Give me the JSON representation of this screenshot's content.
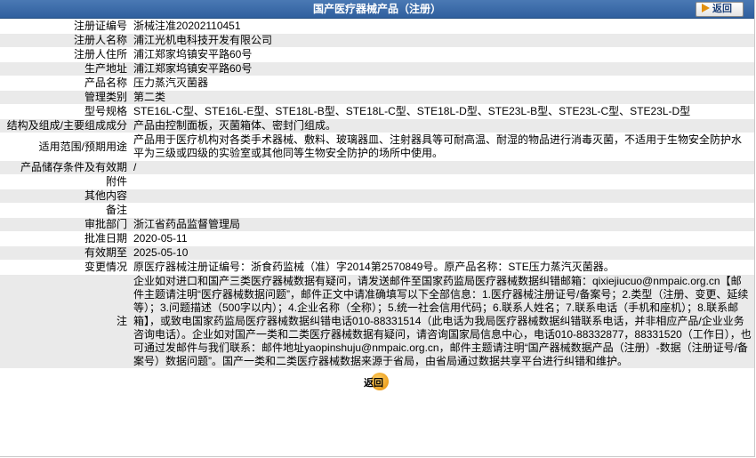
{
  "header": {
    "title": "国产医疗器械产品（注册）",
    "back_label": "返回"
  },
  "rows": [
    {
      "label": "注册证编号",
      "value": "浙械注准20202110451"
    },
    {
      "label": "注册人名称",
      "value": "浦江光机电科技开发有限公司"
    },
    {
      "label": "注册人住所",
      "value": "浦江郑家坞镇安平路60号"
    },
    {
      "label": "生产地址",
      "value": "浦江郑家坞镇安平路60号"
    },
    {
      "label": "产品名称",
      "value": "压力蒸汽灭菌器"
    },
    {
      "label": "管理类别",
      "value": "第二类"
    },
    {
      "label": "型号规格",
      "value": "STE16L-C型、STE16L-E型、STE18L-B型、STE18L-C型、STE18L-D型、STE23L-B型、STE23L-C型、STE23L-D型"
    },
    {
      "label": "结构及组成/主要组成成分",
      "value": "产品由控制面板，灭菌箱体、密封门组成。"
    },
    {
      "label": "适用范围/预期用途",
      "value": "产品用于医疗机构对各类手术器械、敷料、玻璃器皿、注射器具等可耐高温、耐湿的物品进行消毒灭菌，不适用于生物安全防护水平为三级或四级的实验室或其他同等生物安全防护的场所中使用。"
    },
    {
      "label": "产品储存条件及有效期",
      "value": "/"
    },
    {
      "label": "附件",
      "value": ""
    },
    {
      "label": "其他内容",
      "value": ""
    },
    {
      "label": "备注",
      "value": ""
    },
    {
      "label": "审批部门",
      "value": "浙江省药品监督管理局"
    },
    {
      "label": "批准日期",
      "value": "2020-05-11"
    },
    {
      "label": "有效期至",
      "value": "2025-05-10"
    },
    {
      "label": "变更情况",
      "value": "原医疗器械注册证编号：浙食药监械（准）字2014第2570849号。原产品名称：STE压力蒸汽灭菌器。"
    },
    {
      "label": "注",
      "value": "企业如对进口和国产三类医疗器械数据有疑问，请发送邮件至国家药监局医疗器械数据纠错邮箱：qixiejiucuo@nmpaic.org.cn【邮件主题请注明“医疗器械数据问题”，邮件正文中请准确填写以下全部信息：1.医疗器械注册证号/备案号；2.类型（注册、变更、延续等）；3.问题描述（500字以内）；4.企业名称（全称）；5.统一社会信用代码；6.联系人姓名；7.联系电话（手机和座机）；8.联系邮箱】，或致电国家药监局医疗器械数据纠错电话010-88331514（此电话为我局医疗器械数据纠错联系电话，并非相应产品/企业业务咨询电话）。企业如对国产一类和二类医疗器械数据有疑问，请咨询国家局信息中心，电话010-88332877，88331520（工作日），也可通过发邮件与我们联系：邮件地址yaopinshuju@nmpaic.org.cn，邮件主题请注明“国产器械数据产品（注册）-数据（注册证号/备案号）数据问题”。国产一类和二类医疗器械数据来源于省局，由省局通过数据共享平台进行纠错和维护。"
    }
  ],
  "footer": {
    "back_label": "返回"
  }
}
